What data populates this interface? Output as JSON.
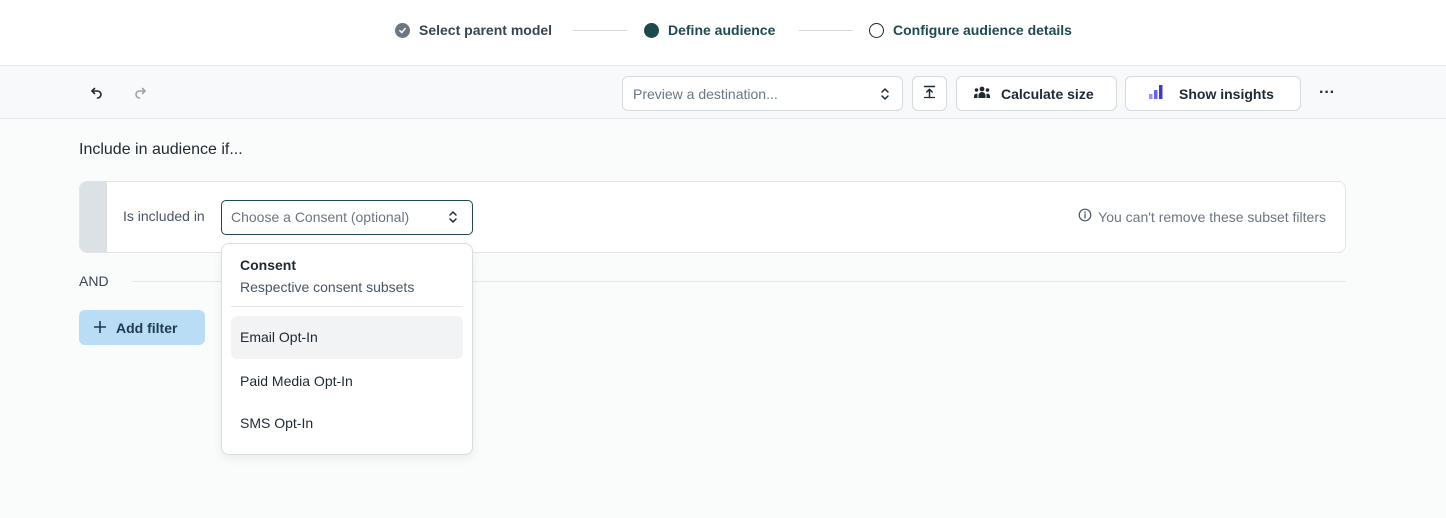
{
  "stepper": {
    "steps": [
      {
        "label": "Select parent model",
        "state": "complete"
      },
      {
        "label": "Define audience",
        "state": "current"
      },
      {
        "label": "Configure audience details",
        "state": "upcoming"
      }
    ]
  },
  "toolbar": {
    "undo_icon": "undo-icon",
    "redo_icon": "redo-icon",
    "preview_placeholder": "Preview a destination...",
    "upload_icon": "upload-icon",
    "calculate_label": "Calculate size",
    "insights_label": "Show insights",
    "more_label": "···"
  },
  "main": {
    "heading": "Include in audience if...",
    "filter": {
      "label": "Is included in",
      "select_placeholder": "Choose a Consent (optional)",
      "note": "You can't remove these subset filters"
    },
    "and_label": "AND",
    "add_filter_label": "Add filter"
  },
  "dropdown": {
    "title": "Consent",
    "subtitle": "Respective consent subsets",
    "options": [
      "Email Opt-In",
      "Paid Media Opt-In",
      "SMS Opt-In"
    ]
  },
  "colors": {
    "accent": "#1e4a4e",
    "add_filter_bg": "#b9ddf5",
    "page_bg": "#fafbfb"
  }
}
